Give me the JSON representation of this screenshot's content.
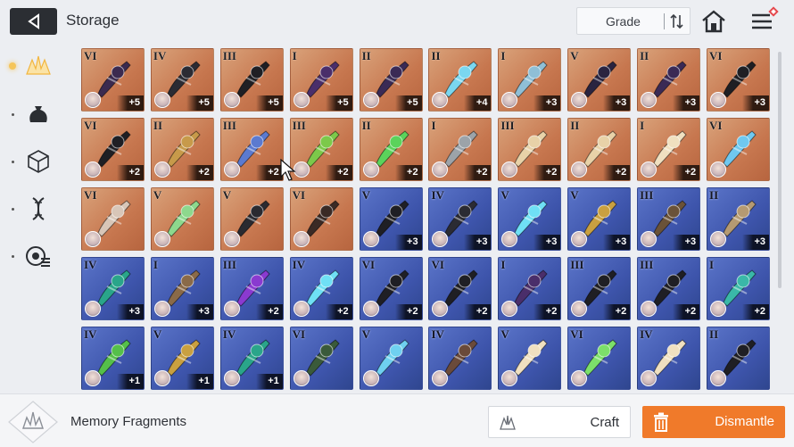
{
  "header": {
    "title": "Storage",
    "sort": {
      "label": "Grade"
    }
  },
  "sidebar": {
    "items": [
      {
        "icon": "memory-fragment-icon",
        "active": true
      },
      {
        "icon": "pouch-icon",
        "active": false
      },
      {
        "icon": "cube-icon",
        "active": false
      },
      {
        "icon": "dna-icon",
        "active": false
      },
      {
        "icon": "gear-list-icon",
        "active": false
      }
    ]
  },
  "items": [
    {
      "grade": "VI",
      "plus": "+5",
      "rarity": "orange",
      "color": "#3b2a4f"
    },
    {
      "grade": "IV",
      "plus": "+5",
      "rarity": "orange",
      "color": "#2b2b33"
    },
    {
      "grade": "III",
      "plus": "+5",
      "rarity": "orange",
      "color": "#1f1f24"
    },
    {
      "grade": "I",
      "plus": "+5",
      "rarity": "orange",
      "color": "#4a2e6a"
    },
    {
      "grade": "II",
      "plus": "+5",
      "rarity": "orange",
      "color": "#3a2a55"
    },
    {
      "grade": "II",
      "plus": "+4",
      "rarity": "orange",
      "color": "#7ad7f0"
    },
    {
      "grade": "I",
      "plus": "+3",
      "rarity": "orange",
      "color": "#8fbfd6"
    },
    {
      "grade": "V",
      "plus": "+3",
      "rarity": "orange",
      "color": "#2a2440"
    },
    {
      "grade": "II",
      "plus": "+3",
      "rarity": "orange",
      "color": "#3a2a55"
    },
    {
      "grade": "VI",
      "plus": "+3",
      "rarity": "orange",
      "color": "#1f1f24"
    },
    {
      "grade": "VI",
      "plus": "+2",
      "rarity": "orange",
      "color": "#1f1f24"
    },
    {
      "grade": "II",
      "plus": "+2",
      "rarity": "orange",
      "color": "#c79a4a"
    },
    {
      "grade": "III",
      "plus": "+2",
      "rarity": "orange",
      "color": "#5b7ad0"
    },
    {
      "grade": "III",
      "plus": "+2",
      "rarity": "orange",
      "color": "#7cc94a"
    },
    {
      "grade": "II",
      "plus": "+2",
      "rarity": "orange",
      "color": "#5bd35b"
    },
    {
      "grade": "I",
      "plus": "+2",
      "rarity": "orange",
      "color": "#9ca3a9"
    },
    {
      "grade": "III",
      "plus": "+2",
      "rarity": "orange",
      "color": "#e8d2a8"
    },
    {
      "grade": "II",
      "plus": "+2",
      "rarity": "orange",
      "color": "#e8d2a8"
    },
    {
      "grade": "I",
      "plus": "+2",
      "rarity": "orange",
      "color": "#f0e0c0"
    },
    {
      "grade": "VI",
      "plus": "",
      "rarity": "orange",
      "color": "#6fc8f0"
    },
    {
      "grade": "VI",
      "plus": "",
      "rarity": "orange",
      "color": "#d8c6b8"
    },
    {
      "grade": "V",
      "plus": "",
      "rarity": "orange",
      "color": "#8dd88d"
    },
    {
      "grade": "V",
      "plus": "",
      "rarity": "orange",
      "color": "#2a2a30"
    },
    {
      "grade": "VI",
      "plus": "",
      "rarity": "orange",
      "color": "#3a2a25"
    },
    {
      "grade": "V",
      "plus": "+3",
      "rarity": "blue",
      "color": "#1f1f24"
    },
    {
      "grade": "IV",
      "plus": "+3",
      "rarity": "blue",
      "color": "#2b2b33"
    },
    {
      "grade": "V",
      "plus": "+3",
      "rarity": "blue",
      "color": "#6fe0f5"
    },
    {
      "grade": "V",
      "plus": "+3",
      "rarity": "blue",
      "color": "#c9a040"
    },
    {
      "grade": "III",
      "plus": "+3",
      "rarity": "blue",
      "color": "#6a5238"
    },
    {
      "grade": "II",
      "plus": "+3",
      "rarity": "blue",
      "color": "#b59a72"
    },
    {
      "grade": "IV",
      "plus": "+3",
      "rarity": "blue",
      "color": "#2aa58a"
    },
    {
      "grade": "I",
      "plus": "+3",
      "rarity": "blue",
      "color": "#8a6a48"
    },
    {
      "grade": "III",
      "plus": "+2",
      "rarity": "blue",
      "color": "#8a3ad0"
    },
    {
      "grade": "IV",
      "plus": "+2",
      "rarity": "blue",
      "color": "#6fe0f5"
    },
    {
      "grade": "VI",
      "plus": "+2",
      "rarity": "blue",
      "color": "#1f1f24"
    },
    {
      "grade": "VI",
      "plus": "+2",
      "rarity": "blue",
      "color": "#1f1f24"
    },
    {
      "grade": "I",
      "plus": "+2",
      "rarity": "blue",
      "color": "#4a2e6a"
    },
    {
      "grade": "III",
      "plus": "+2",
      "rarity": "blue",
      "color": "#1f1f24"
    },
    {
      "grade": "III",
      "plus": "+2",
      "rarity": "blue",
      "color": "#1f1f24"
    },
    {
      "grade": "I",
      "plus": "+2",
      "rarity": "blue",
      "color": "#3ab8a8"
    },
    {
      "grade": "IV",
      "plus": "+1",
      "rarity": "blue",
      "color": "#55c04a"
    },
    {
      "grade": "V",
      "plus": "+1",
      "rarity": "blue",
      "color": "#c9a040"
    },
    {
      "grade": "IV",
      "plus": "+1",
      "rarity": "blue",
      "color": "#2aa58a"
    },
    {
      "grade": "VI",
      "plus": "",
      "rarity": "blue",
      "color": "#3a5a3a"
    },
    {
      "grade": "V",
      "plus": "",
      "rarity": "blue",
      "color": "#6fd0f0"
    },
    {
      "grade": "IV",
      "plus": "",
      "rarity": "blue",
      "color": "#6a4a3a"
    },
    {
      "grade": "V",
      "plus": "",
      "rarity": "blue",
      "color": "#f0e0c0"
    },
    {
      "grade": "VI",
      "plus": "",
      "rarity": "blue",
      "color": "#7ce06a"
    },
    {
      "grade": "IV",
      "plus": "",
      "rarity": "blue",
      "color": "#f0e0c0"
    },
    {
      "grade": "II",
      "plus": "",
      "rarity": "blue",
      "color": "#1f1f24"
    }
  ],
  "footer": {
    "category_label": "Memory Fragments",
    "craft_label": "Craft",
    "dismantle_label": "Dismantle"
  },
  "colors": {
    "accent": "#f07a2a",
    "orange_card": "#c7774f",
    "blue_card": "#3e55ac"
  }
}
